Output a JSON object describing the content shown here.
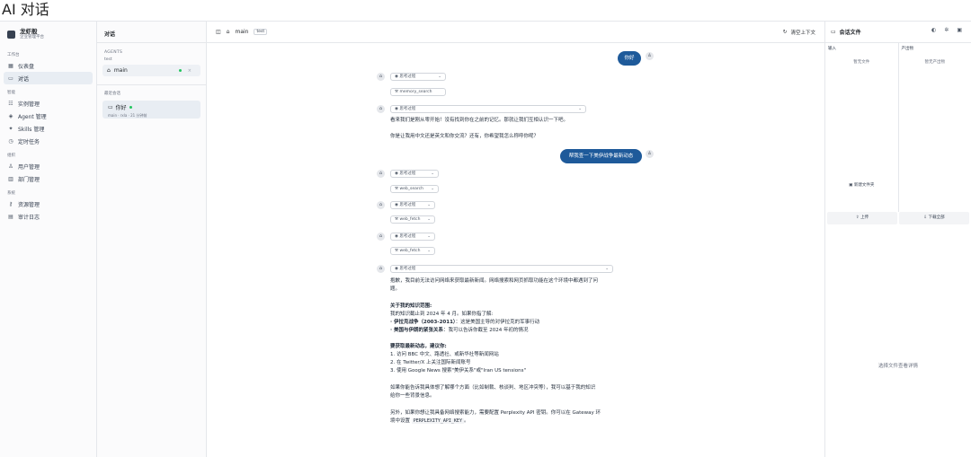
{
  "page_title": "AI 对话",
  "brand": {
    "name": "龙虾般",
    "subtitle": "企业管理平台"
  },
  "nav": {
    "groups": [
      {
        "label": "工作台",
        "items": [
          {
            "label": "仪表盘",
            "icon": "dashboard-icon",
            "glyph": "▦"
          },
          {
            "label": "对话",
            "icon": "chat-icon",
            "glyph": "▭",
            "active": true
          }
        ]
      },
      {
        "label": "智能",
        "items": [
          {
            "label": "实例管理",
            "icon": "list-icon",
            "glyph": "☷"
          },
          {
            "label": "Agent 管理",
            "icon": "robot-icon",
            "glyph": "◈"
          },
          {
            "label": "Skills 管理",
            "icon": "sparkle-icon",
            "glyph": "✦"
          },
          {
            "label": "定时任务",
            "icon": "clock-icon",
            "glyph": "◷"
          }
        ]
      },
      {
        "label": "组织",
        "items": [
          {
            "label": "用户管理",
            "icon": "user-icon",
            "glyph": "♙"
          },
          {
            "label": "部门管理",
            "icon": "building-icon",
            "glyph": "▥"
          }
        ]
      },
      {
        "label": "系统",
        "items": [
          {
            "label": "资源管理",
            "icon": "key-icon",
            "glyph": "⚷"
          },
          {
            "label": "审计日志",
            "icon": "log-icon",
            "glyph": "▤"
          }
        ]
      }
    ]
  },
  "convs": {
    "header": "对话",
    "agents_label": "AGENTS",
    "agent_group": "test",
    "agent_name": "main",
    "recent_label": "最近会话",
    "recent_title": "你好",
    "recent_meta": "main · rxla · 21 分钟前"
  },
  "chat_header": {
    "title": "对话",
    "agent": "main",
    "tag": "test",
    "clear_label": "清空上下文"
  },
  "messages": {
    "user1": "你好",
    "thinking": "思考过程",
    "tool1": "memory_search",
    "reply1_line1": "看来我们是刚从零开始！没有找到你在之前的记忆。那就让我们互相认识一下吧。",
    "reply1_line2": "你是让我用中文还是英文和你交流？还有，你希望我怎么称呼你呢？",
    "user2": "帮我查一下美伊战争最新动态",
    "tool2": "web_search",
    "tool3": "web_fetch",
    "tool4": "web_fetch",
    "reply2_p1a": "抱歉，我目前无法访问网络来获取最新新闻。网络搜索和网页抓取功能在这个环境中都遇到了问",
    "reply2_p1b": "题。",
    "reply2_h1": "关于我的知识范围:",
    "reply2_k1": "我的知识截止到 2024 年 4 月。如果你指了解:",
    "reply2_k2_b": "· 伊拉克战争（2003-2011）",
    "reply2_k2": "：这是美国主导的对伊拉克的军事行动",
    "reply2_k3_b": "· 美国与伊朗的紧张关系",
    "reply2_k3": "：我可以告诉你截至 2024 年初的情况",
    "reply2_h2": "要获取最新动态，建议你:",
    "reply2_s1": "1. 访问 BBC 中文、路透社、或新华社等新闻网站",
    "reply2_s2": "2. 在 Twitter/X 上关注国际新闻账号",
    "reply2_s3": "3. 使用 Google News 搜索\"美伊关系\"或\"Iran US tensions\"",
    "reply2_p3a": "如果你能告诉我具体想了解哪个方面（比如制裁、核谈判、地区冲突等），我可以基于我的知识",
    "reply2_p3b": "给你一些背景信息。",
    "reply2_p4a": "另外，如果你想让我具备网络搜索能力，需要配置 Perplexity API 密钥。你可以在 Gateway 环",
    "reply2_p4b": "境中设置",
    "reply2_code": "PERPLEXITY_API_KEY",
    "reply2_p4c": "。"
  },
  "files": {
    "header": "会话文件",
    "input_label": "输入",
    "output_label": "产出物",
    "input_empty": "暂无文件",
    "output_empty": "暂无产出物",
    "new_folder": "新建文件夹",
    "upload": "上传",
    "download_all": "下载全部",
    "detail_hint": "选择文件查看详情"
  },
  "colors": {
    "accent": "#1e5a9a",
    "online": "#22c55e"
  }
}
